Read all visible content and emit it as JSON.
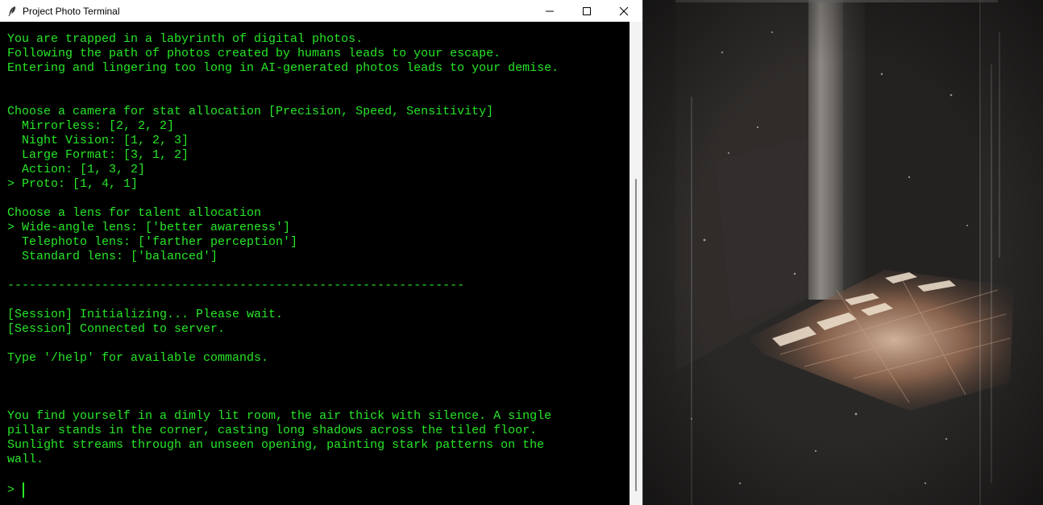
{
  "window": {
    "title": "Project Photo Terminal",
    "icon": "feather-icon"
  },
  "terminal": {
    "text_color": "#27e627",
    "background": "#000000",
    "lines": [
      "You are trapped in a labyrinth of digital photos.",
      "Following the path of photos created by humans leads to your escape.",
      "Entering and lingering too long in AI-generated photos leads to your demise.",
      "",
      "",
      "Choose a camera for stat allocation [Precision, Speed, Sensitivity]",
      "  Mirrorless: [2, 2, 2]",
      "  Night Vision: [1, 2, 3]",
      "  Large Format: [3, 1, 2]",
      "  Action: [1, 3, 2]",
      "> Proto: [1, 4, 1]",
      "",
      "Choose a lens for talent allocation",
      "> Wide-angle lens: ['better awareness']",
      "  Telephoto lens: ['farther perception']",
      "  Standard lens: ['balanced']",
      "",
      "---------------------------------------------------------------",
      "",
      "[Session] Initializing... Please wait.",
      "[Session] Connected to server.",
      "",
      "Type '/help' for available commands.",
      "",
      "",
      "",
      "You find yourself in a dimly lit room, the air thick with silence. A single",
      "pillar stands in the corner, casting long shadows across the tiled floor.",
      "Sunlight streams through an unseen opening, painting stark patterns on the",
      "wall."
    ],
    "prompt": ">"
  },
  "scene": {
    "icon": "photo-scene-image"
  }
}
